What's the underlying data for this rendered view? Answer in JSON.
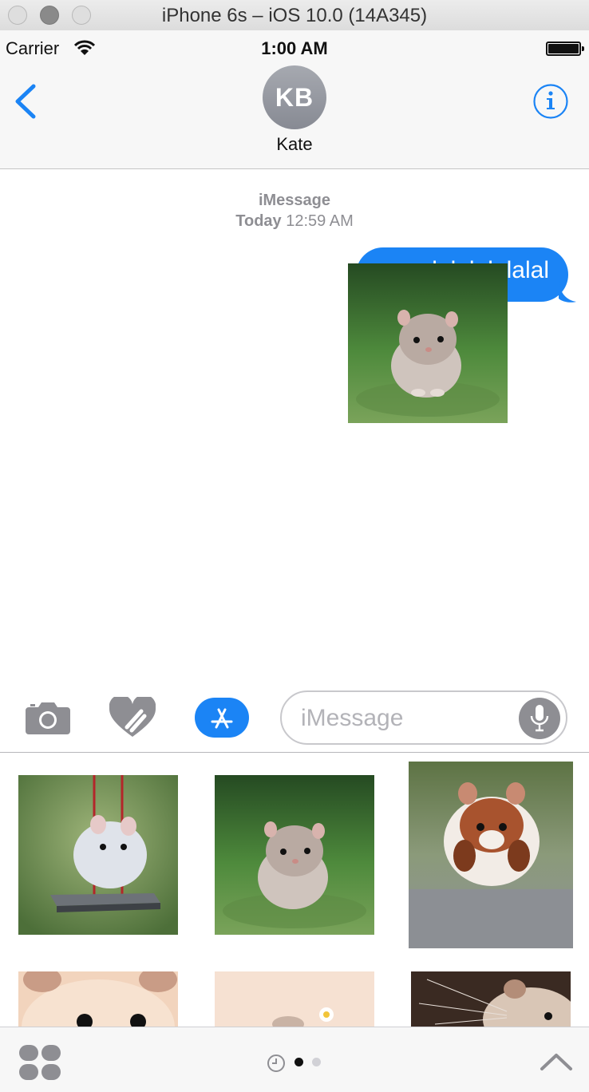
{
  "window": {
    "title": "iPhone 6s – iOS 10.0 (14A345)"
  },
  "status": {
    "carrier": "Carrier",
    "time": "1:00 AM"
  },
  "nav": {
    "back_icon": "chevron-left-icon",
    "avatar_initials": "KB",
    "contact_name": "Kate",
    "info_icon": "info-icon"
  },
  "conversation": {
    "service": "iMessage",
    "day": "Today",
    "time": "12:59 AM",
    "sent_message": "lalalalalalal",
    "sticker": "hamster-on-grass"
  },
  "input": {
    "placeholder": "iMessage",
    "icons": [
      "camera-icon",
      "digital-touch-icon",
      "app-store-icon",
      "microphone-icon"
    ]
  },
  "drawer": {
    "stickers": [
      {
        "name": "hamster-on-swing"
      },
      {
        "name": "hamster-on-grass"
      },
      {
        "name": "hamster-jumping"
      },
      {
        "name": "hamster-closeup"
      },
      {
        "name": "hamster-with-flower"
      },
      {
        "name": "hamster-whiskers"
      }
    ],
    "page_count": 2,
    "current_page": 1
  },
  "colors": {
    "accent": "#1b84f5",
    "bubble_text": "#ffffff",
    "meta": "#8e8e93"
  }
}
